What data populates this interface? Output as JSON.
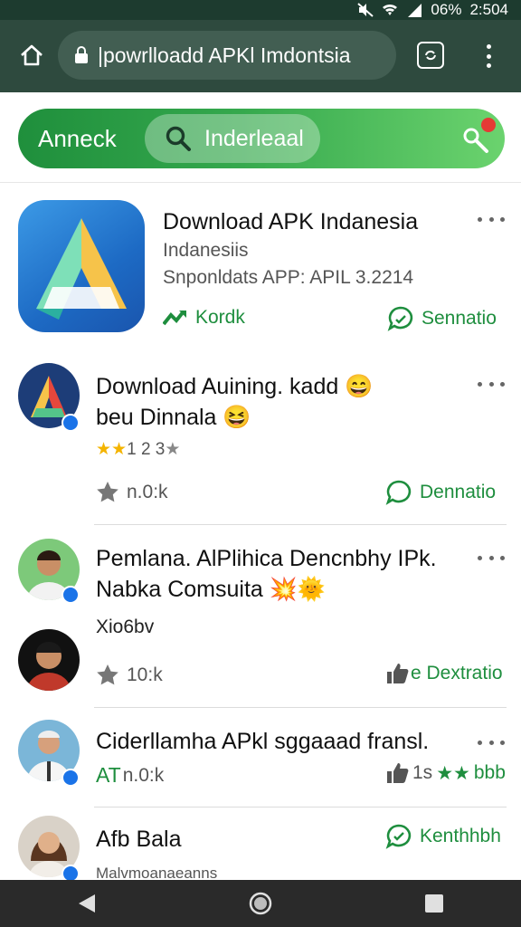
{
  "status_bar": {
    "battery": "06%",
    "time": "2:504"
  },
  "browser": {
    "url": "|powrlloadd APKl Imdontsia"
  },
  "search": {
    "brand": "Anneck",
    "query": "Inderleaal"
  },
  "feed": [
    {
      "title": "Download APK Indanesia",
      "subtitle": "Indanesiis",
      "meta": "Snponldats APP: APIL 3.2214",
      "action_left": "Kordk",
      "action_right": "Sennatio"
    },
    {
      "title_line1": "Download Auining. kadd",
      "title_line2": "beu Dinnala",
      "rating_text": "1 2 3",
      "count": "n.0:k",
      "action_right": "Dennatio"
    },
    {
      "title_line1": "Pemlana. AlPlihica Dencnbhy IPk.",
      "title_line2": "Nabka Comsuita",
      "tag": "Xio6bv",
      "count": "10:k",
      "action_right": "e Dextratio"
    },
    {
      "title": "Ciderllamha APkl sggaaad fransl.",
      "count_prefix": "AT",
      "count": "n.0:k",
      "action_right_text": "1s",
      "action_right_suffix": "bbb"
    },
    {
      "title": "Afb Bala",
      "subtitle": "Malvmoanaeanns",
      "action_right": "Kenthhbh"
    }
  ],
  "colors": {
    "accent_green": "#1e8e3e",
    "chrome": "#2e4a3e",
    "status_bar": "#1d3b2f",
    "badge_blue": "#1a73e8",
    "notification_red": "#e53935"
  }
}
